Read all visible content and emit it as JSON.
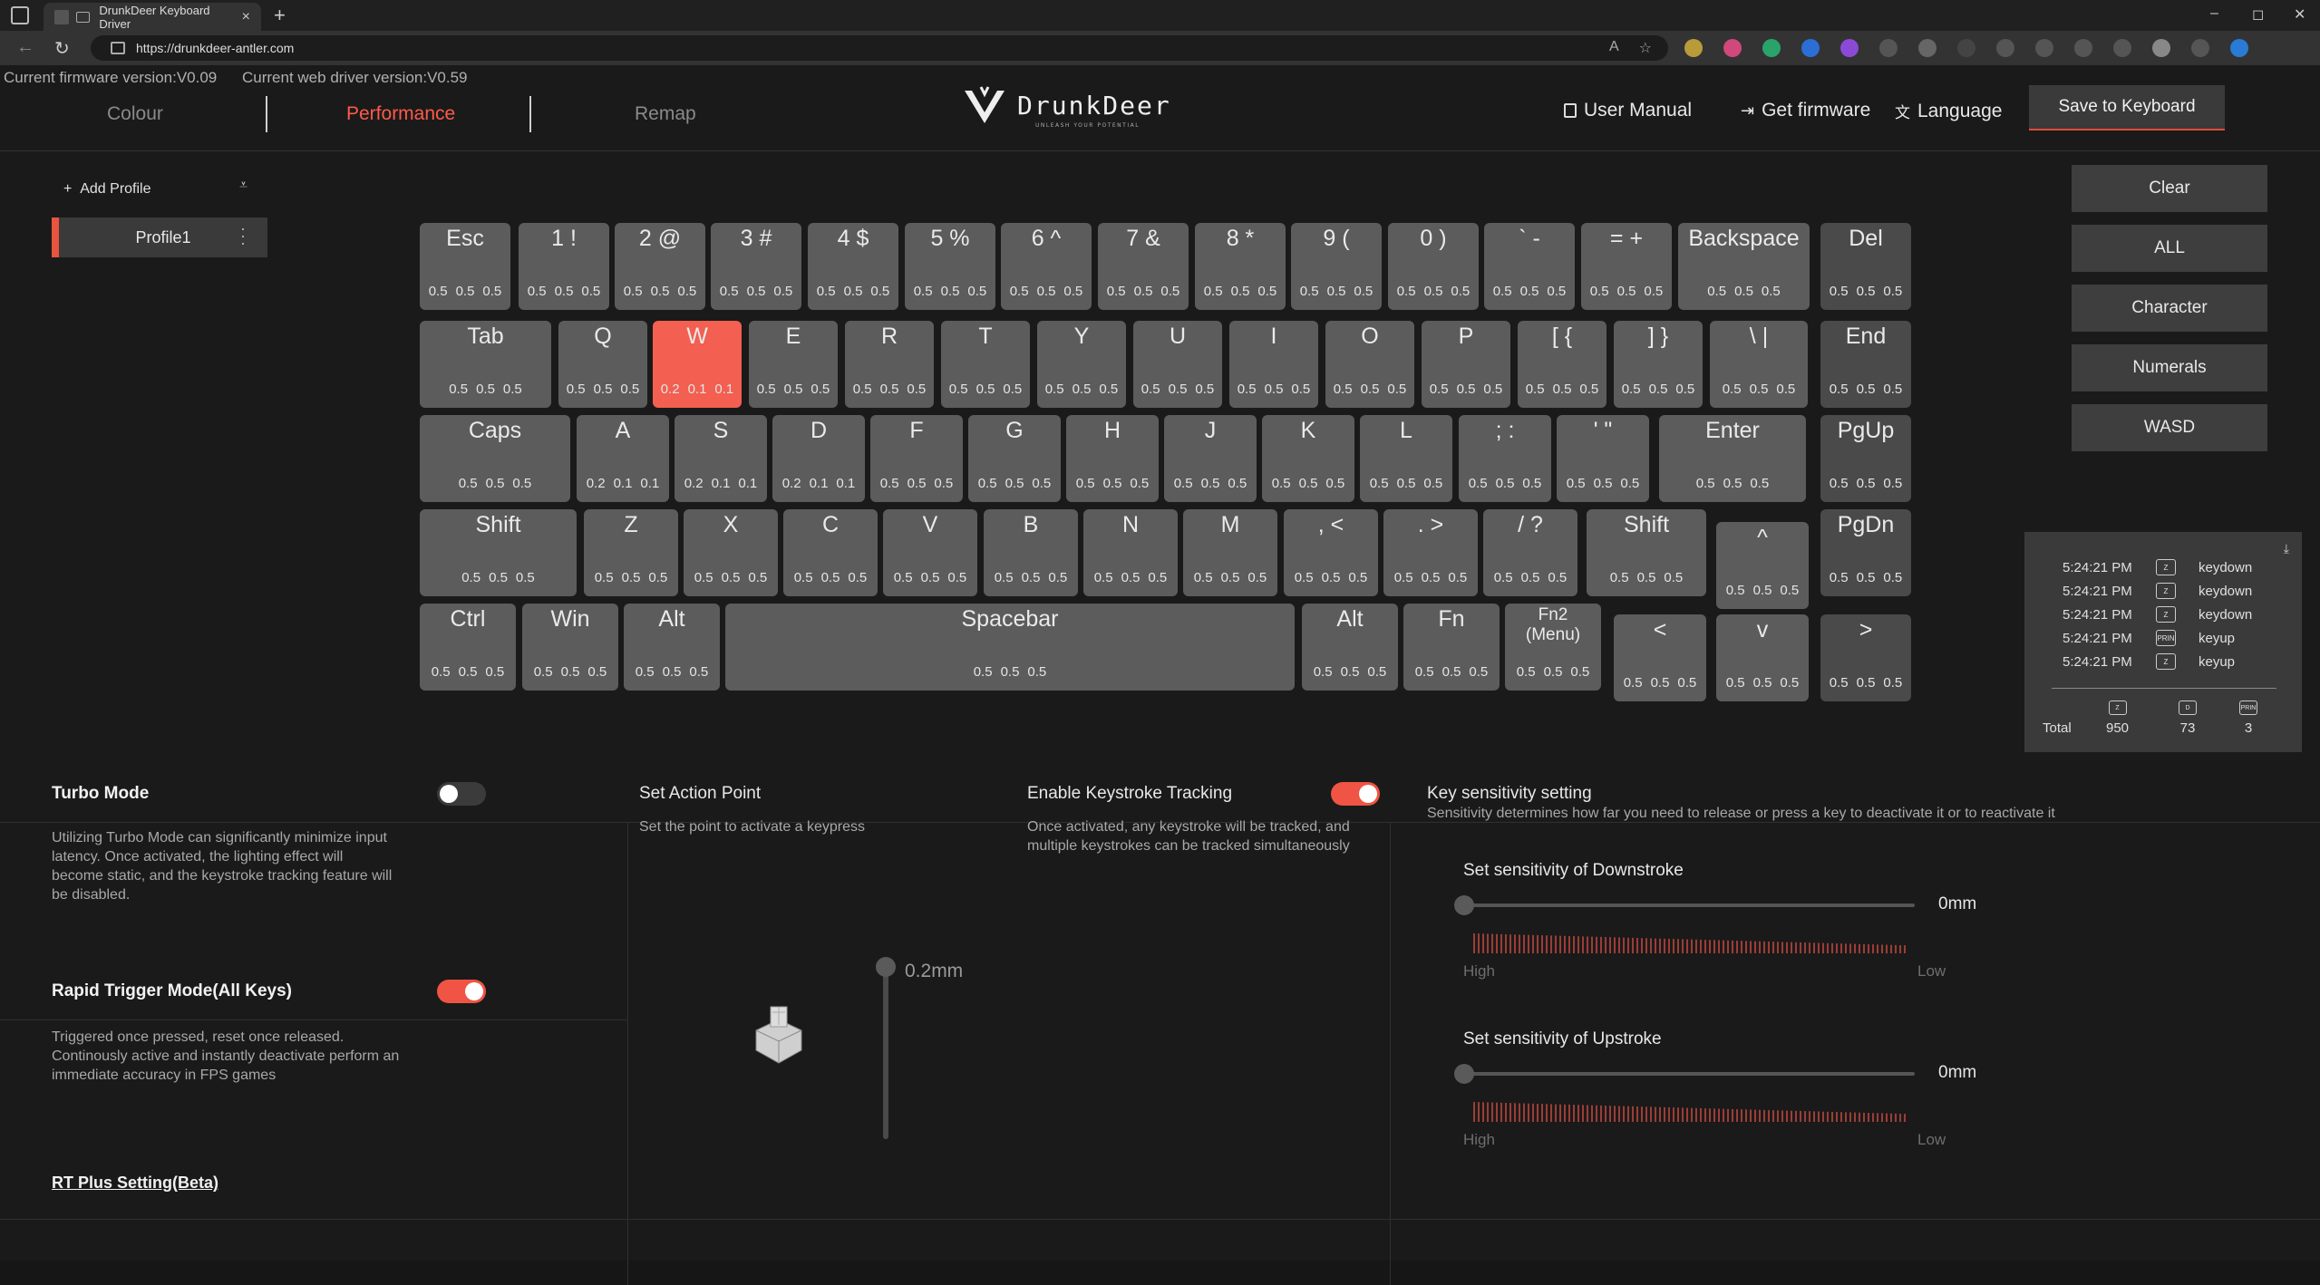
{
  "browser": {
    "tab_title": "DrunkDeer Keyboard Driver",
    "close_glyph": "×",
    "new_tab_glyph": "+",
    "url": "https://drunkdeer-antler.com",
    "window_controls": [
      "–",
      "◻",
      "✕"
    ],
    "nav_icons": [
      "back-arrow-icon",
      "reload-icon"
    ]
  },
  "header": {
    "firmware": "Current firmware version:V0.09",
    "driver": "Current web driver version:V0.59",
    "tabs": [
      {
        "label": "Colour",
        "active": false
      },
      {
        "label": "Performance",
        "active": true
      },
      {
        "label": "Remap",
        "active": false
      }
    ],
    "logo_text": "DrunkDeer",
    "logo_tagline": "UNLEASH YOUR POTENTIAL",
    "links": {
      "manual": "User Manual",
      "firmware": "Get firmware",
      "language": "Language"
    },
    "save_label": "Save to Keyboard",
    "accent_color": "#f05444"
  },
  "profiles": {
    "add_label": "Add Profile",
    "items": [
      {
        "name": "Profile1",
        "active": true
      }
    ]
  },
  "keyboard": {
    "rows": [
      [
        {
          "label": "Esc",
          "vals": [
            "0.5",
            "0.5",
            "0.5"
          ]
        },
        {
          "label": "1 !",
          "vals": [
            "0.5",
            "0.5",
            "0.5"
          ]
        },
        {
          "label": "2 @",
          "vals": [
            "0.5",
            "0.5",
            "0.5"
          ]
        },
        {
          "label": "3 #",
          "vals": [
            "0.5",
            "0.5",
            "0.5"
          ]
        },
        {
          "label": "4 $",
          "vals": [
            "0.5",
            "0.5",
            "0.5"
          ]
        },
        {
          "label": "5 %",
          "vals": [
            "0.5",
            "0.5",
            "0.5"
          ]
        },
        {
          "label": "6 ^",
          "vals": [
            "0.5",
            "0.5",
            "0.5"
          ]
        },
        {
          "label": "7 &",
          "vals": [
            "0.5",
            "0.5",
            "0.5"
          ]
        },
        {
          "label": "8 *",
          "vals": [
            "0.5",
            "0.5",
            "0.5"
          ]
        },
        {
          "label": "9 (",
          "vals": [
            "0.5",
            "0.5",
            "0.5"
          ]
        },
        {
          "label": "0 )",
          "vals": [
            "0.5",
            "0.5",
            "0.5"
          ]
        },
        {
          "label": "` -",
          "vals": [
            "0.5",
            "0.5",
            "0.5"
          ]
        },
        {
          "label": "= +",
          "vals": [
            "0.5",
            "0.5",
            "0.5"
          ]
        },
        {
          "label": "Backspace",
          "vals": [
            "0.5",
            "0.5",
            "0.5"
          ]
        },
        {
          "label": "Del",
          "vals": [
            "0.5",
            "0.5",
            "0.5"
          ]
        }
      ],
      [
        {
          "label": "Tab",
          "vals": [
            "0.5",
            "0.5",
            "0.5"
          ]
        },
        {
          "label": "Q",
          "vals": [
            "0.5",
            "0.5",
            "0.5"
          ]
        },
        {
          "label": "W",
          "vals": [
            "0.2",
            "0.1",
            "0.1"
          ],
          "selected": true
        },
        {
          "label": "E",
          "vals": [
            "0.5",
            "0.5",
            "0.5"
          ]
        },
        {
          "label": "R",
          "vals": [
            "0.5",
            "0.5",
            "0.5"
          ]
        },
        {
          "label": "T",
          "vals": [
            "0.5",
            "0.5",
            "0.5"
          ]
        },
        {
          "label": "Y",
          "vals": [
            "0.5",
            "0.5",
            "0.5"
          ]
        },
        {
          "label": "U",
          "vals": [
            "0.5",
            "0.5",
            "0.5"
          ]
        },
        {
          "label": "I",
          "vals": [
            "0.5",
            "0.5",
            "0.5"
          ]
        },
        {
          "label": "O",
          "vals": [
            "0.5",
            "0.5",
            "0.5"
          ]
        },
        {
          "label": "P",
          "vals": [
            "0.5",
            "0.5",
            "0.5"
          ]
        },
        {
          "label": "[ {",
          "vals": [
            "0.5",
            "0.5",
            "0.5"
          ]
        },
        {
          "label": "] }",
          "vals": [
            "0.5",
            "0.5",
            "0.5"
          ]
        },
        {
          "label": "\\ |",
          "vals": [
            "0.5",
            "0.5",
            "0.5"
          ]
        },
        {
          "label": "End",
          "vals": [
            "0.5",
            "0.5",
            "0.5"
          ]
        }
      ],
      [
        {
          "label": "Caps",
          "vals": [
            "0.5",
            "0.5",
            "0.5"
          ]
        },
        {
          "label": "A",
          "vals": [
            "0.2",
            "0.1",
            "0.1"
          ]
        },
        {
          "label": "S",
          "vals": [
            "0.2",
            "0.1",
            "0.1"
          ]
        },
        {
          "label": "D",
          "vals": [
            "0.2",
            "0.1",
            "0.1"
          ]
        },
        {
          "label": "F",
          "vals": [
            "0.5",
            "0.5",
            "0.5"
          ]
        },
        {
          "label": "G",
          "vals": [
            "0.5",
            "0.5",
            "0.5"
          ]
        },
        {
          "label": "H",
          "vals": [
            "0.5",
            "0.5",
            "0.5"
          ]
        },
        {
          "label": "J",
          "vals": [
            "0.5",
            "0.5",
            "0.5"
          ]
        },
        {
          "label": "K",
          "vals": [
            "0.5",
            "0.5",
            "0.5"
          ]
        },
        {
          "label": "L",
          "vals": [
            "0.5",
            "0.5",
            "0.5"
          ]
        },
        {
          "label": "; :",
          "vals": [
            "0.5",
            "0.5",
            "0.5"
          ]
        },
        {
          "label": "' \"",
          "vals": [
            "0.5",
            "0.5",
            "0.5"
          ]
        },
        {
          "label": "Enter",
          "vals": [
            "0.5",
            "0.5",
            "0.5"
          ]
        },
        {
          "label": "PgUp",
          "vals": [
            "0.5",
            "0.5",
            "0.5"
          ]
        }
      ],
      [
        {
          "label": "Shift",
          "vals": [
            "0.5",
            "0.5",
            "0.5"
          ]
        },
        {
          "label": "Z",
          "vals": [
            "0.5",
            "0.5",
            "0.5"
          ]
        },
        {
          "label": "X",
          "vals": [
            "0.5",
            "0.5",
            "0.5"
          ]
        },
        {
          "label": "C",
          "vals": [
            "0.5",
            "0.5",
            "0.5"
          ]
        },
        {
          "label": "V",
          "vals": [
            "0.5",
            "0.5",
            "0.5"
          ]
        },
        {
          "label": "B",
          "vals": [
            "0.5",
            "0.5",
            "0.5"
          ]
        },
        {
          "label": "N",
          "vals": [
            "0.5",
            "0.5",
            "0.5"
          ]
        },
        {
          "label": "M",
          "vals": [
            "0.5",
            "0.5",
            "0.5"
          ]
        },
        {
          "label": ", <",
          "vals": [
            "0.5",
            "0.5",
            "0.5"
          ]
        },
        {
          "label": ". >",
          "vals": [
            "0.5",
            "0.5",
            "0.5"
          ]
        },
        {
          "label": "/ ?",
          "vals": [
            "0.5",
            "0.5",
            "0.5"
          ]
        },
        {
          "label": "Shift",
          "vals": [
            "0.5",
            "0.5",
            "0.5"
          ]
        },
        {
          "label": "^",
          "vals": [
            "0.5",
            "0.5",
            "0.5"
          ]
        },
        {
          "label": "PgDn",
          "vals": [
            "0.5",
            "0.5",
            "0.5"
          ]
        }
      ],
      [
        {
          "label": "Ctrl",
          "vals": [
            "0.5",
            "0.5",
            "0.5"
          ]
        },
        {
          "label": "Win",
          "vals": [
            "0.5",
            "0.5",
            "0.5"
          ]
        },
        {
          "label": "Alt",
          "vals": [
            "0.5",
            "0.5",
            "0.5"
          ]
        },
        {
          "label": "Spacebar",
          "vals": [
            "0.5",
            "0.5",
            "0.5"
          ]
        },
        {
          "label": "Alt",
          "vals": [
            "0.5",
            "0.5",
            "0.5"
          ]
        },
        {
          "label": "Fn",
          "vals": [
            "0.5",
            "0.5",
            "0.5"
          ]
        },
        {
          "label": "Fn2\n(Menu)",
          "vals": [
            "0.5",
            "0.5",
            "0.5"
          ]
        },
        {
          "label": "<",
          "vals": [
            "0.5",
            "0.5",
            "0.5"
          ]
        },
        {
          "label": "v",
          "vals": [
            "0.5",
            "0.5",
            "0.5"
          ]
        },
        {
          "label": ">",
          "vals": [
            "0.5",
            "0.5",
            "0.5"
          ]
        }
      ]
    ]
  },
  "presets": [
    "Clear",
    "ALL",
    "Character",
    "Numerals",
    "WASD"
  ],
  "keylog": {
    "entries": [
      {
        "time": "5:24:21 PM",
        "key": "Z",
        "event": "keydown"
      },
      {
        "time": "5:24:21 PM",
        "key": "Z",
        "event": "keydown"
      },
      {
        "time": "5:24:21 PM",
        "key": "Z",
        "event": "keydown"
      },
      {
        "time": "5:24:21 PM",
        "key": "PRIN",
        "event": "keyup"
      },
      {
        "time": "5:24:21 PM",
        "key": "Z",
        "event": "keyup"
      }
    ],
    "total_label": "Total",
    "totals": [
      {
        "key": "Z",
        "count": "950"
      },
      {
        "key": "D",
        "count": "73"
      },
      {
        "key": "PRIN",
        "count": "3"
      }
    ]
  },
  "turbo": {
    "title": "Turbo Mode",
    "enabled": false,
    "desc": "Utilizing Turbo Mode can significantly minimize input latency. Once activated, the lighting effect will become static, and the keystroke tracking feature will be disabled."
  },
  "rapid_trigger": {
    "title": "Rapid Trigger Mode(All Keys)",
    "enabled": true,
    "desc": "Triggered once pressed, reset once released. Continously active and instantly deactivate perform an immediate accuracy in FPS games",
    "link": "RT Plus Setting(Beta)"
  },
  "action_point": {
    "title": "Set Action Point",
    "desc": "Set the point to activate a keypress",
    "value": "0.2mm"
  },
  "tracking": {
    "title": "Enable Keystroke Tracking",
    "enabled": true,
    "desc": "Once activated, any keystroke will be tracked, and multiple keystrokes can be tracked simultaneously"
  },
  "sensitivity": {
    "title": "Key sensitivity setting",
    "desc": "Sensitivity determines how far you need to release or press a key to deactivate it or to reactivate it",
    "down_label": "Set sensitivity of Downstroke",
    "down_value": "0mm",
    "up_label": "Set sensitivity of Upstroke",
    "up_value": "0mm",
    "high": "High",
    "low": "Low"
  }
}
